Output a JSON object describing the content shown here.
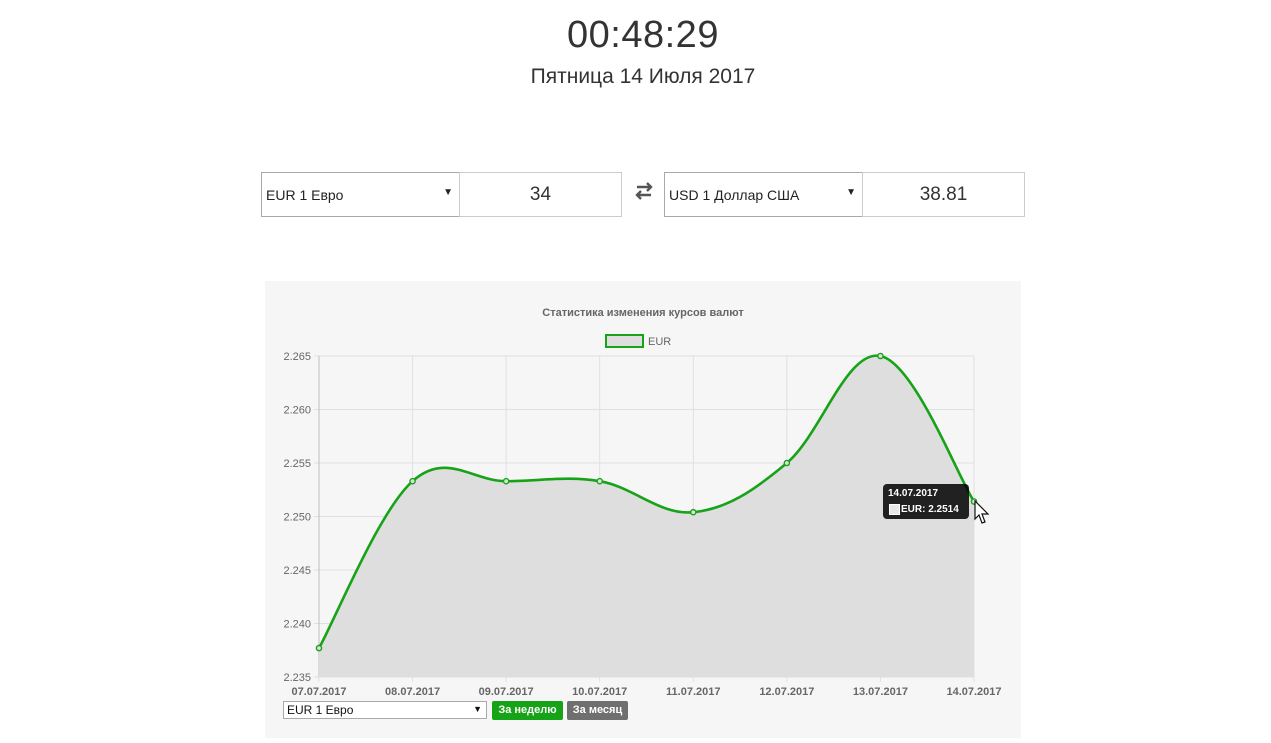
{
  "header": {
    "time": "00:48:29",
    "date": "Пятница 14 Июля 2017"
  },
  "converter": {
    "from_currency": "EUR 1 Евро",
    "from_amount": "34",
    "to_currency": "USD 1 Доллар США",
    "to_amount": "38.81",
    "swap_icon": "swap-arrows-icon"
  },
  "chart_controls": {
    "currency_select": "EUR 1 Евро",
    "week_button": "За неделю",
    "month_button": "За месяц"
  },
  "tooltip": {
    "title": "14.07.2017",
    "value": "EUR: 2.2514"
  },
  "colors": {
    "line": "#17a317",
    "fill": "#dedede",
    "week_button": "#17a317",
    "month_button": "#6f6f6f"
  },
  "chart_data": {
    "type": "line",
    "title": "Статистика изменения курсов валют",
    "categories": [
      "07.07.2017",
      "08.07.2017",
      "09.07.2017",
      "10.07.2017",
      "11.07.2017",
      "12.07.2017",
      "13.07.2017",
      "14.07.2017"
    ],
    "series": [
      {
        "name": "EUR",
        "values": [
          2.2377,
          2.2533,
          2.2533,
          2.2533,
          2.2504,
          2.255,
          2.265,
          2.2514
        ]
      }
    ],
    "ylim": [
      2.235,
      2.265
    ],
    "yticks": [
      "2.235",
      "2.240",
      "2.245",
      "2.250",
      "2.255",
      "2.260",
      "2.265"
    ],
    "legend_position": "top-center",
    "grid": true,
    "fill": true
  }
}
